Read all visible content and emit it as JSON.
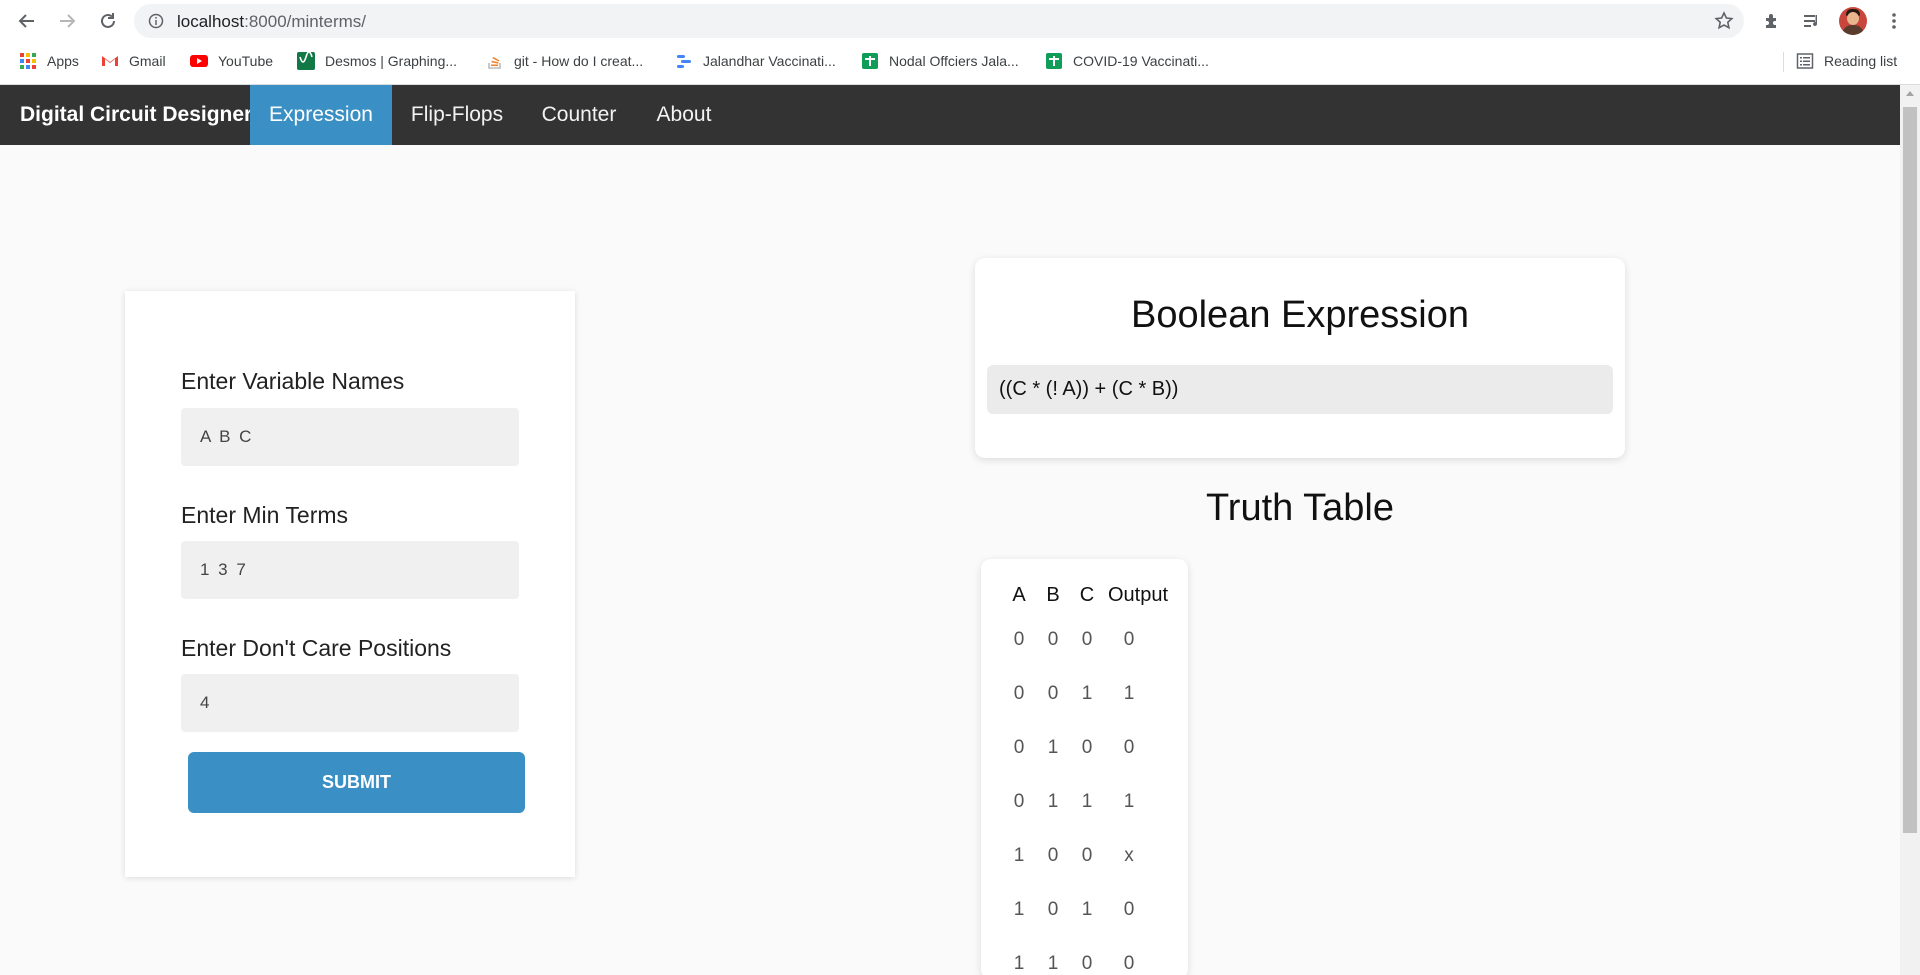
{
  "browser": {
    "url_host": "localhost",
    "url_path": ":8000/minterms/",
    "bookmarks": [
      {
        "label": "Apps"
      },
      {
        "label": "Gmail"
      },
      {
        "label": "YouTube"
      },
      {
        "label": "Desmos | Graphing..."
      },
      {
        "label": "git - How do I creat..."
      },
      {
        "label": "Jalandhar Vaccinati..."
      },
      {
        "label": "Nodal Offciers Jala..."
      },
      {
        "label": "COVID-19 Vaccinati..."
      }
    ],
    "reading_list": "Reading list"
  },
  "navbar": {
    "brand": "Digital Circuit Designer",
    "links": [
      {
        "label": "Expression",
        "active": true
      },
      {
        "label": "Flip-Flops",
        "active": false
      },
      {
        "label": "Counter",
        "active": false
      },
      {
        "label": "About",
        "active": false
      }
    ]
  },
  "form": {
    "variables_label": "Enter Variable Names",
    "variables_value": "A B C",
    "minterms_label": "Enter Min Terms",
    "minterms_value": "1 3 7",
    "dontcare_label": "Enter Don't Care Positions",
    "dontcare_value": "4",
    "submit_label": "SUBMIT"
  },
  "expression": {
    "title": "Boolean Expression",
    "value": "((C * (! A)) + (C * B))"
  },
  "truth_table": {
    "title": "Truth Table",
    "headers": [
      "A",
      "B",
      "C",
      "Output"
    ],
    "rows": [
      [
        "0",
        "0",
        "0",
        "0"
      ],
      [
        "0",
        "0",
        "1",
        "1"
      ],
      [
        "0",
        "1",
        "0",
        "0"
      ],
      [
        "0",
        "1",
        "1",
        "1"
      ],
      [
        "1",
        "0",
        "0",
        "x"
      ],
      [
        "1",
        "0",
        "1",
        "0"
      ],
      [
        "1",
        "1",
        "0",
        "0"
      ]
    ]
  },
  "colors": {
    "navbar_bg": "#333333",
    "accent": "#3a8fc4",
    "page_bg": "#fafafa"
  }
}
